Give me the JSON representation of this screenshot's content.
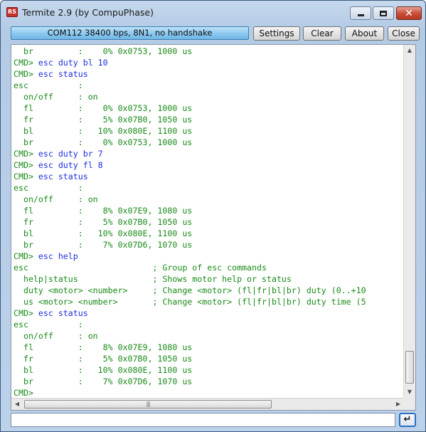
{
  "window": {
    "title": "Termite 2.9 (by CompuPhase)",
    "icon_glyph": "RS"
  },
  "toolbar": {
    "status": "COM112 38400 bps, 8N1, no handshake",
    "settings_label": "Settings",
    "clear_label": "Clear",
    "about_label": "About",
    "close_label": "Close"
  },
  "terminal": {
    "lines": [
      {
        "type": "out",
        "text": "  br         :    0% 0x0753, 1000 us"
      },
      {
        "type": "cmd",
        "prompt": "CMD> ",
        "text": "esc duty bl 10"
      },
      {
        "type": "cmd",
        "prompt": "CMD> ",
        "text": "esc status"
      },
      {
        "type": "out",
        "text": "esc          :"
      },
      {
        "type": "out",
        "text": "  on/off     : on"
      },
      {
        "type": "out",
        "text": "  fl         :    0% 0x0753, 1000 us"
      },
      {
        "type": "out",
        "text": "  fr         :    5% 0x07B0, 1050 us"
      },
      {
        "type": "out",
        "text": "  bl         :   10% 0x080E, 1100 us"
      },
      {
        "type": "out",
        "text": "  br         :    0% 0x0753, 1000 us"
      },
      {
        "type": "cmd",
        "prompt": "CMD> ",
        "text": "esc duty br 7"
      },
      {
        "type": "cmd",
        "prompt": "CMD> ",
        "text": "esc duty fl 8"
      },
      {
        "type": "cmd",
        "prompt": "CMD> ",
        "text": "esc status"
      },
      {
        "type": "out",
        "text": "esc          :"
      },
      {
        "type": "out",
        "text": "  on/off     : on"
      },
      {
        "type": "out",
        "text": "  fl         :    8% 0x07E9, 1080 us"
      },
      {
        "type": "out",
        "text": "  fr         :    5% 0x07B0, 1050 us"
      },
      {
        "type": "out",
        "text": "  bl         :   10% 0x080E, 1100 us"
      },
      {
        "type": "out",
        "text": "  br         :    7% 0x07D6, 1070 us"
      },
      {
        "type": "cmd",
        "prompt": "CMD> ",
        "text": "esc help"
      },
      {
        "type": "out",
        "text": "esc                         ; Group of esc commands"
      },
      {
        "type": "out",
        "text": "  help|status               ; Shows motor help or status"
      },
      {
        "type": "out",
        "text": "  duty <motor> <number>     ; Change <motor> (fl|fr|bl|br) duty (0..+10"
      },
      {
        "type": "out",
        "text": "  us <motor> <number>       ; Change <motor> (fl|fr|bl|br) duty time (5"
      },
      {
        "type": "cmd",
        "prompt": "CMD> ",
        "text": "esc status"
      },
      {
        "type": "out",
        "text": "esc          :"
      },
      {
        "type": "out",
        "text": "  on/off     : on"
      },
      {
        "type": "out",
        "text": "  fl         :    8% 0x07E9, 1080 us"
      },
      {
        "type": "out",
        "text": "  fr         :    5% 0x07B0, 1050 us"
      },
      {
        "type": "out",
        "text": "  bl         :   10% 0x080E, 1100 us"
      },
      {
        "type": "out",
        "text": "  br         :    7% 0x07D6, 1070 us"
      },
      {
        "type": "cmd",
        "prompt": "CMD> ",
        "text": ""
      }
    ]
  },
  "scrollbars": {
    "horizontal_thumb_grip": "|||"
  },
  "input": {
    "value": "",
    "placeholder": ""
  },
  "icons": {
    "minimize": "minimize-icon",
    "maximize": "maximize-icon",
    "close": "close-icon",
    "send": "enter-icon",
    "scroll_up": "scroll-up-icon",
    "scroll_down": "scroll-down-icon",
    "scroll_left": "scroll-left-icon",
    "scroll_right": "scroll-right-icon"
  },
  "colors": {
    "output_text": "#1a8a1a",
    "command_text": "#1c2ee0",
    "status_bar": "#8fcaf0",
    "close_button": "#c9503c"
  }
}
